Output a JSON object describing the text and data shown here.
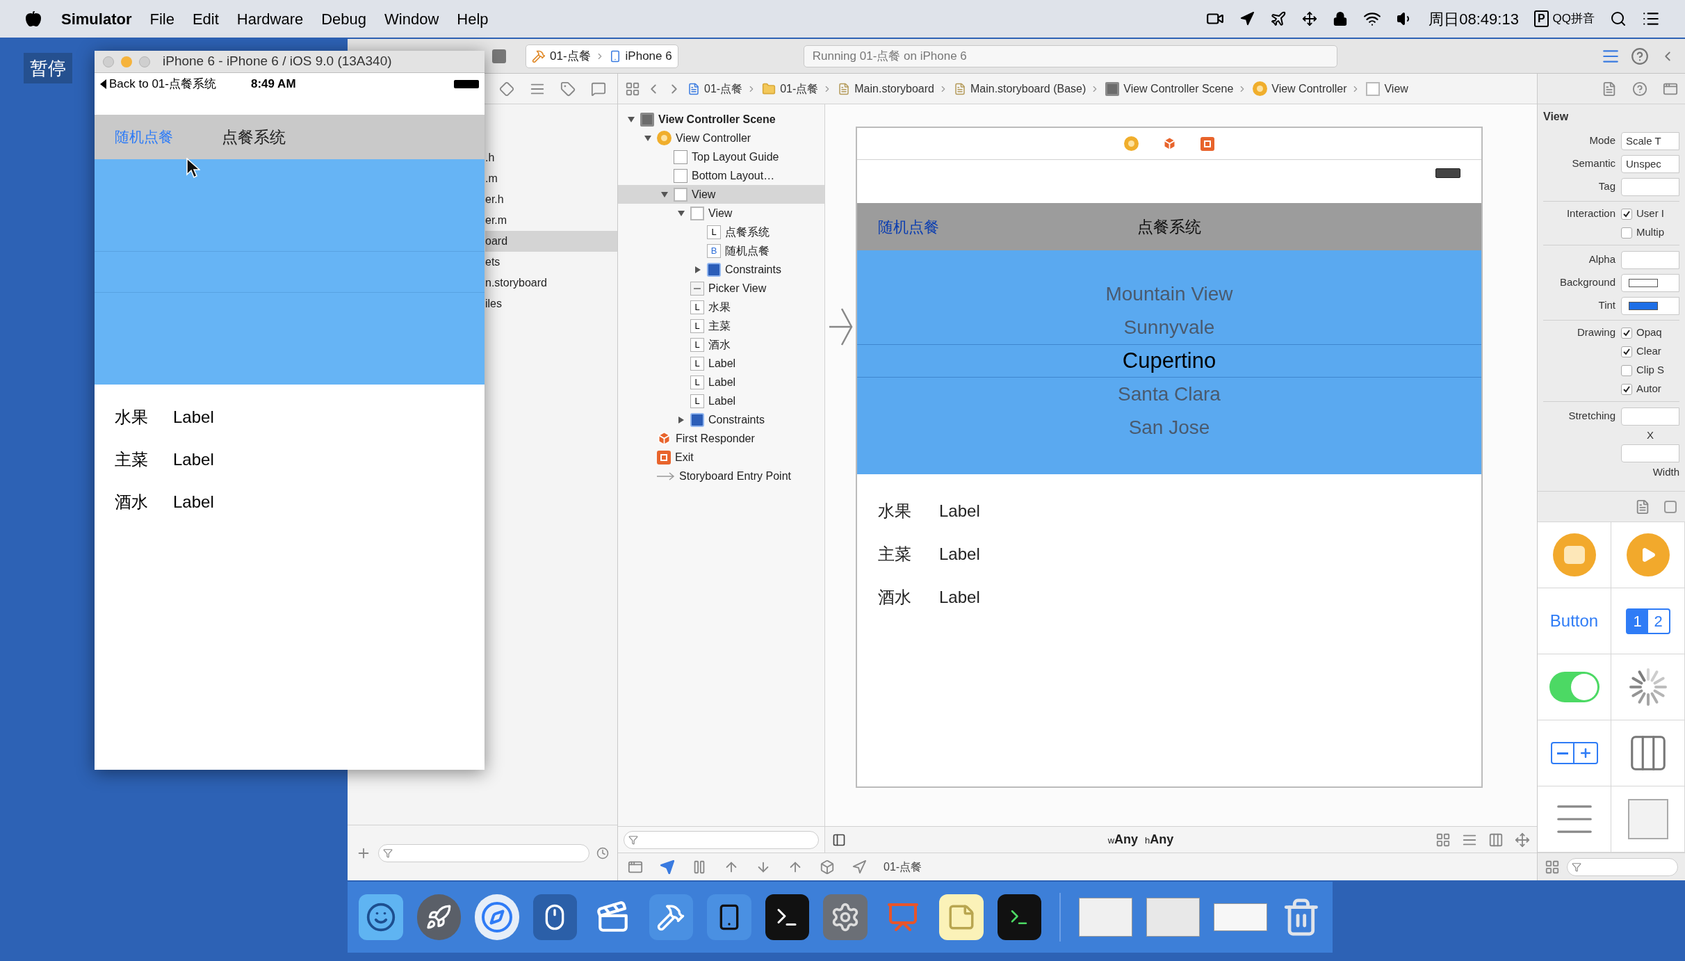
{
  "menu_bar": {
    "app": "Simulator",
    "menus": [
      "File",
      "Edit",
      "Hardware",
      "Debug",
      "Window",
      "Help"
    ],
    "clock": "周日08:49:13",
    "input_badge": "P",
    "input_method": "QQ拼音"
  },
  "desktop": {
    "badge": "暂停"
  },
  "simulator": {
    "title": "iPhone 6 - iPhone 6 / iOS 9.0 (13A340)",
    "back": "Back to 01-点餐系统",
    "time": "8:49 AM",
    "nav_button": "随机点餐",
    "nav_title": "点餐系统",
    "rows": [
      {
        "name": "水果",
        "value": "Label"
      },
      {
        "name": "主菜",
        "value": "Label"
      },
      {
        "name": "酒水",
        "value": "Label"
      }
    ]
  },
  "xcode": {
    "toolbar": {
      "scheme": "01-点餐",
      "device": "iPhone 6",
      "activity": "Running 01-点餐 on iPhone 6"
    },
    "navigator": {
      "items": [
        {
          "label": ".h",
          "selected": false
        },
        {
          "label": ".m",
          "selected": false
        },
        {
          "label": "er.h",
          "selected": false
        },
        {
          "label": "er.m",
          "selected": false
        },
        {
          "label": "oard",
          "selected": true
        },
        {
          "label": "ets",
          "selected": false
        },
        {
          "label": "n.storyboard",
          "selected": false
        },
        {
          "label": "iles",
          "selected": false
        }
      ]
    },
    "jump_bar": [
      {
        "label": "01-点餐",
        "kind": "project"
      },
      {
        "label": "01-点餐",
        "kind": "folder"
      },
      {
        "label": "Main.storyboard",
        "kind": "file"
      },
      {
        "label": "Main.storyboard (Base)",
        "kind": "file"
      },
      {
        "label": "View Controller Scene",
        "kind": "scene"
      },
      {
        "label": "View Controller",
        "kind": "controller"
      },
      {
        "label": "View",
        "kind": "view"
      }
    ],
    "outline": [
      {
        "label": "View Controller Scene",
        "kind": "scene",
        "expanded": true,
        "selected": false,
        "children": [
          {
            "label": "View Controller",
            "kind": "controller",
            "expanded": true,
            "selected": false,
            "children": [
              {
                "label": "Top Layout Guide",
                "kind": "guide",
                "selected": false
              },
              {
                "label": "Bottom Layout…",
                "kind": "guide",
                "selected": false
              },
              {
                "label": "View",
                "kind": "view",
                "expanded": true,
                "selected": true,
                "children": [
                  {
                    "label": "View",
                    "kind": "view",
                    "expanded": true,
                    "selected": false,
                    "children": [
                      {
                        "label": "点餐系统",
                        "kind": "label",
                        "badge": "L",
                        "selected": false
                      },
                      {
                        "label": "随机点餐",
                        "kind": "button",
                        "badge": "B",
                        "selected": false
                      },
                      {
                        "label": "Constraints",
                        "kind": "constraints",
                        "expanded": false,
                        "selected": false
                      }
                    ]
                  },
                  {
                    "label": "Picker View",
                    "kind": "picker",
                    "selected": false
                  },
                  {
                    "label": "水果",
                    "kind": "label",
                    "badge": "L",
                    "selected": false
                  },
                  {
                    "label": "主菜",
                    "kind": "label",
                    "badge": "L",
                    "selected": false
                  },
                  {
                    "label": "酒水",
                    "kind": "label",
                    "badge": "L",
                    "selected": false
                  },
                  {
                    "label": "Label",
                    "kind": "label",
                    "badge": "L",
                    "selected": false
                  },
                  {
                    "label": "Label",
                    "kind": "label",
                    "badge": "L",
                    "selected": false
                  },
                  {
                    "label": "Label",
                    "kind": "label",
                    "badge": "L",
                    "selected": false
                  },
                  {
                    "label": "Constraints",
                    "kind": "constraints",
                    "expanded": false,
                    "selected": false
                  }
                ]
              }
            ]
          },
          {
            "label": "First Responder",
            "kind": "responder",
            "selected": false
          },
          {
            "label": "Exit",
            "kind": "exit",
            "selected": false
          },
          {
            "label": "Storyboard Entry Point",
            "kind": "entry",
            "selected": false
          }
        ]
      }
    ],
    "canvas": {
      "nav_button": "随机点餐",
      "nav_title": "点餐系统",
      "picker": [
        {
          "label": "Mountain View",
          "selected": false
        },
        {
          "label": "Sunnyvale",
          "selected": false
        },
        {
          "label": "Cupertino",
          "selected": true
        },
        {
          "label": "Santa Clara",
          "selected": false
        },
        {
          "label": "San Jose",
          "selected": false
        }
      ],
      "rows": [
        {
          "name": "水果",
          "value": "Label"
        },
        {
          "name": "主菜",
          "value": "Label"
        },
        {
          "name": "酒水",
          "value": "Label"
        }
      ],
      "size_classes": [
        {
          "prefix": "w",
          "value": "Any"
        },
        {
          "prefix": "h",
          "value": "Any"
        }
      ]
    },
    "debug_bar": {
      "target": "01-点餐"
    },
    "inspector": {
      "title": "View",
      "fields": [
        {
          "kind": "select",
          "label": "Mode",
          "value": "Scale T"
        },
        {
          "kind": "select",
          "label": "Semantic",
          "value": "Unspec"
        },
        {
          "kind": "text",
          "label": "Tag"
        },
        {
          "kind": "divider"
        },
        {
          "kind": "checkbox",
          "label": "Interaction",
          "text": "User I",
          "checked": true
        },
        {
          "kind": "checkbox",
          "text": "Multip",
          "checked": false
        },
        {
          "kind": "divider"
        },
        {
          "kind": "text",
          "label": "Alpha"
        },
        {
          "kind": "color",
          "label": "Background",
          "color": "#ffffff"
        },
        {
          "kind": "color",
          "label": "Tint",
          "color": "#1e6fe6"
        },
        {
          "kind": "divider"
        },
        {
          "kind": "checkbox",
          "label": "Drawing",
          "text": "Opaq",
          "checked": true
        },
        {
          "kind": "checkbox",
          "text": "Clear",
          "checked": true
        },
        {
          "kind": "checkbox",
          "text": "Clip S",
          "checked": false
        },
        {
          "kind": "checkbox",
          "text": "Autor",
          "checked": true
        },
        {
          "kind": "divider"
        },
        {
          "kind": "stretch",
          "label": "Stretching",
          "axis": "X",
          "caption": "Width"
        }
      ]
    },
    "library": {
      "button_label": "Button",
      "segments": [
        "1",
        "2"
      ]
    }
  }
}
